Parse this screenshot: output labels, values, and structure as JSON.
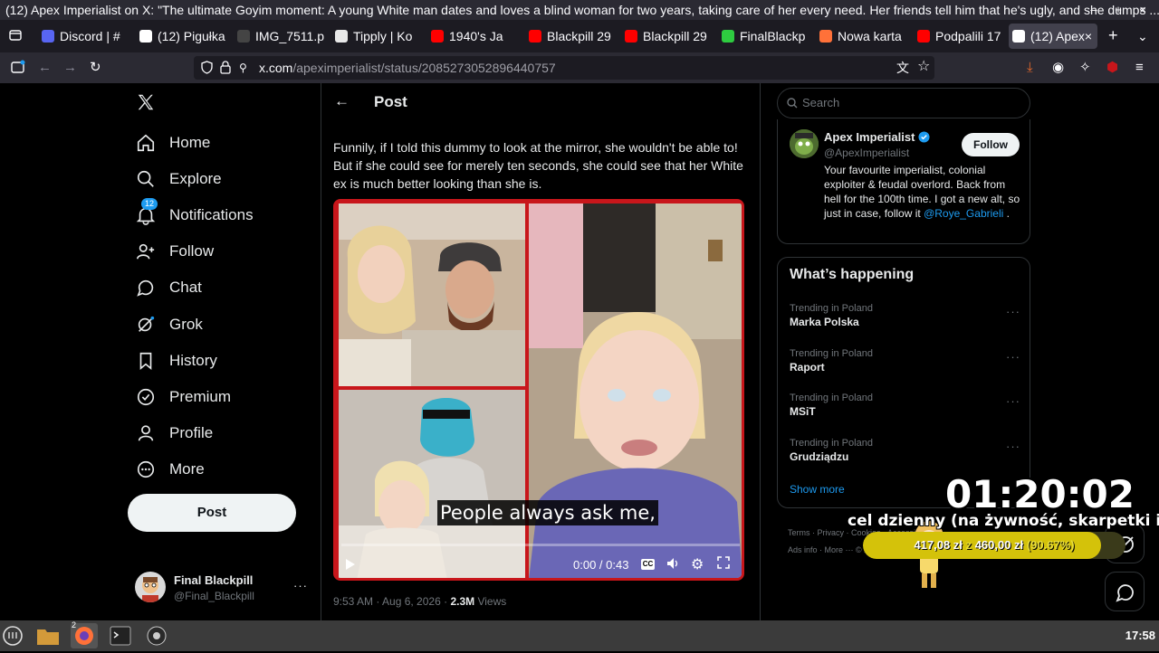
{
  "window": {
    "title": "(12) Apex Imperialist on X: \"The ultimate Goyim moment: A young White man dates and loves a blind woman for two years, taking care of her every need. Her friends tell him that he's ugly, and she dumps ...",
    "controls": "– + ×"
  },
  "tabs": [
    {
      "label": "Discord | #",
      "color": "#5865f2"
    },
    {
      "label": "(12) Pigułka",
      "color": "#ffffff"
    },
    {
      "label": "IMG_7511.png",
      "color": "#444444"
    },
    {
      "label": "Tipply | Ko",
      "color": "#e8e8e8"
    },
    {
      "label": "1940's Ja",
      "color": "#ff0000"
    },
    {
      "label": "Blackpill 29",
      "color": "#ff0000"
    },
    {
      "label": "Blackpill 29",
      "color": "#ff0000"
    },
    {
      "label": "FinalBlackp",
      "color": "#2ecc40"
    },
    {
      "label": "Nowa karta",
      "color": "#ff7139"
    },
    {
      "label": "Podpalili 17",
      "color": "#ff0000"
    },
    {
      "label": "(12) Apex",
      "color": "#ffffff"
    }
  ],
  "address": {
    "domain": "x.com",
    "path": "/apeximperialist/status/2085273052896440757"
  },
  "sidebar": {
    "items": [
      {
        "label": "Home",
        "icon": "home-icon"
      },
      {
        "label": "Explore",
        "icon": "search-icon"
      },
      {
        "label": "Notifications",
        "icon": "bell-icon",
        "badge": "12"
      },
      {
        "label": "Follow",
        "icon": "person-plus-icon"
      },
      {
        "label": "Chat",
        "icon": "chat-icon"
      },
      {
        "label": "Grok",
        "icon": "grok-icon"
      },
      {
        "label": "History",
        "icon": "bookmark-icon"
      },
      {
        "label": "Premium",
        "icon": "verified-icon"
      },
      {
        "label": "Profile",
        "icon": "person-icon"
      },
      {
        "label": "More",
        "icon": "more-circle-icon"
      }
    ],
    "post_label": "Post",
    "account": {
      "name": "Final Blackpill",
      "handle": "@Final_Blackpill"
    }
  },
  "post": {
    "header": "Post",
    "text": "Funnily, if I told this dummy to look at the mirror, she wouldn't be able to! But if she could see for merely ten seconds, she could see that her White ex is much better looking than she is.",
    "caption": "People always ask me,",
    "time": "0:00 / 0:43",
    "date": "9:53 AM · Aug 6, 2026 ·",
    "views_count": "2.3M",
    "views_label": "Views",
    "progress": 0
  },
  "right": {
    "search_placeholder": "Search",
    "profile": {
      "name": "Apex Imperialist",
      "handle": "@ApexImperialist",
      "follow_label": "Follow",
      "bio": "Your favourite imperialist, colonial exploiter & feudal overlord. Back from hell for the 100th time. I got a new alt, so just in case, follow it",
      "bio_link": "@Roye_Gabrieli",
      "bio_end": "."
    },
    "happening_title": "What’s happening",
    "trends": [
      {
        "context": "Trending in Poland",
        "name": "Marka Polska"
      },
      {
        "context": "Trending in Poland",
        "name": "Raport"
      },
      {
        "context": "Trending in Poland",
        "name": "MSiT"
      },
      {
        "context": "Trending in Poland",
        "name": "Grudziądzu"
      }
    ],
    "show_more": "Show more",
    "footer_line1": "Terms · Privacy · Cookies · Accessibility",
    "footer_line2": "Ads info · More ··· © 2026 X Corp."
  },
  "overlay": {
    "timer": "01:20:02",
    "goal_label": "cel dzienny (na żywność, skarpetki itp)",
    "goal_amount": "417,08 zł",
    "goal_sep": "z",
    "goal_target": "460,00 zł",
    "goal_pct": "(90.67%)",
    "goal_fraction": 0.9067
  },
  "taskbar": {
    "clock": "17:58"
  },
  "colors": {
    "accent": "#1d9bf0",
    "media_border": "#c8161b",
    "goal_fill": "#d4c20a"
  }
}
